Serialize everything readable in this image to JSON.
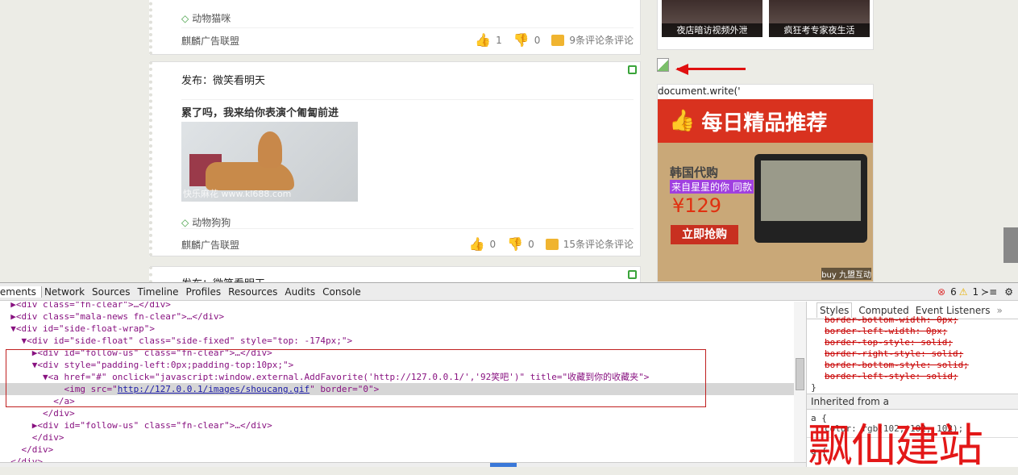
{
  "feed": {
    "post1": {
      "tag": "动物猫咪",
      "source": "麒麟广告联盟",
      "likes": "1",
      "dislikes": "0",
      "comments": "9条评论条评论"
    },
    "post2": {
      "publisher": "发布：微笑看明天",
      "title": "累了吗，我来给你表演个匍匐前进",
      "image_watermark": "快乐麻花 www.kl688.com",
      "tag": "动物狗狗",
      "source": "麒麟广告联盟",
      "likes": "0",
      "dislikes": "0",
      "comments": "15条评论条评论"
    },
    "post3": {
      "publisher": "发布：微笑看明天"
    }
  },
  "sidebar": {
    "thumbs": [
      {
        "caption": "夜店暗访视频外泄"
      },
      {
        "caption": "疯狂考专家夜生活"
      }
    ],
    "broken_image_alt": "",
    "doc_write": "document.write('",
    "ad": {
      "header": "每日精品推荐",
      "line1": "韩国代购",
      "line2": "来自星星的你 同款",
      "price": "¥129",
      "button": "立即抢购",
      "brand": "buy 九盟互动",
      "accent": "#d9321f"
    }
  },
  "devtools": {
    "tabs": [
      "Elements",
      "Network",
      "Sources",
      "Timeline",
      "Profiles",
      "Resources",
      "Audits",
      "Console"
    ],
    "errors": "6",
    "warnings": "1",
    "dom_lines": [
      "  ▶<div class=\"fn-clear\">…</div>",
      "  ▶<div class=\"mala-news fn-clear\">…</div>",
      "  ▼<div id=\"side-float-wrap\">",
      "    ▼<div id=\"side-float\" class=\"side-fixed\" style=\"top: -174px;\">",
      "      ▶<div id=\"follow-us\" class=\"fn-clear\">…</div>",
      "      ▼<div style=\"padding-left:0px;padding-top:10px;\">",
      "        ▼<a href=\"#\" onclick=\"javascript:window.external.AddFavorite('http://127.0.0.1/','92笑吧')\" title=\"收藏到你的收藏夹\">",
      "            <img src=\"",
      "          </a>",
      "        </div>",
      "      ▶<div id=\"follow-us\" class=\"fn-clear\">…</div>",
      "      </div>",
      "    </div>",
      "  </div>"
    ],
    "img_src": "http://127.0.0.1/images/shoucang.gif",
    "img_rest": "\" border=\"0\">",
    "styles_tabs": [
      "Styles",
      "Computed",
      "Event Listeners",
      "»"
    ],
    "struck": [
      "border-bottom-width: 0px;",
      "border-left-width: 0px;",
      "border-top-style: solid;",
      "border-right-style: solid;",
      "border-bottom-style: solid;",
      "border-left-style: solid;"
    ],
    "close_brace": "}",
    "inherited": "Inherited from a",
    "rule_sel": "a {",
    "rule_prop": "color: rgb(102, 102, 102);",
    "rule2": "a {"
  },
  "watermark": "飘仙建站"
}
